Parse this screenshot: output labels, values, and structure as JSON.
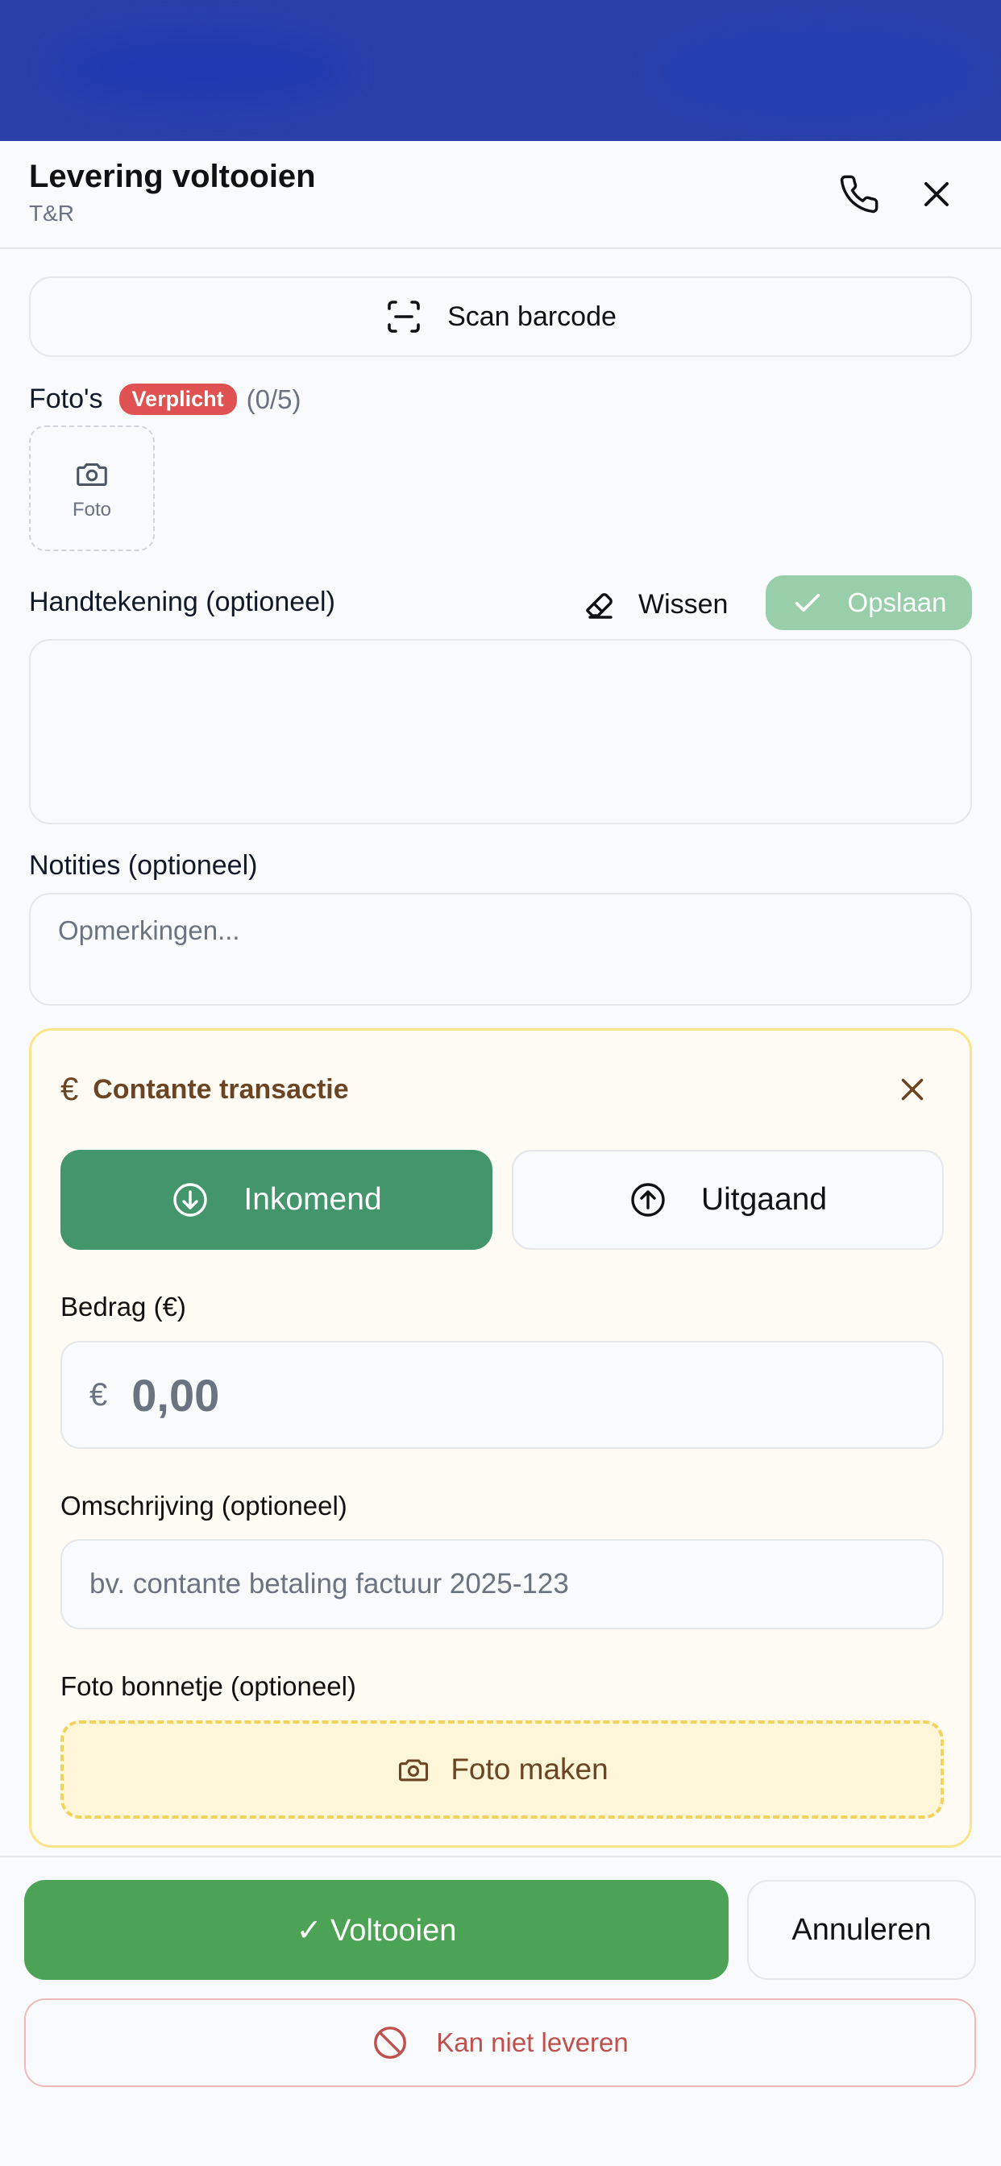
{
  "header": {
    "title": "Levering voltooien",
    "subtitle": "T&R",
    "phone_icon": "phone-icon",
    "close_icon": "close-icon"
  },
  "scan": {
    "label": "Scan barcode",
    "icon": "barcode-scan-icon"
  },
  "photos": {
    "label": "Foto's",
    "badge": "Verplicht",
    "count": "(0/5)",
    "slot_label": "Foto",
    "slot_icon": "camera-icon"
  },
  "signature": {
    "label": "Handtekening (optioneel)",
    "clear_label": "Wissen",
    "save_label": "Opslaan"
  },
  "notes": {
    "label": "Notities (optioneel)",
    "placeholder": "Opmerkingen..."
  },
  "cash": {
    "title": "Contante transactie",
    "currency_symbol": "€",
    "incoming_label": "Inkomend",
    "outgoing_label": "Uitgaand",
    "amount_label": "Bedrag (€)",
    "amount_value": "0,00",
    "description_label": "Omschrijving (optioneel)",
    "description_placeholder": "bv. contante betaling factuur 2025-123",
    "receipt_label": "Foto bonnetje (optioneel)",
    "receipt_button": "Foto maken",
    "selected_direction": "Inkomend"
  },
  "footer": {
    "complete_label": "✓ Voltooien",
    "cancel_label": "Annuleren",
    "fail_label": "Kan niet leveren"
  },
  "colors": {
    "top_bar": "#2a3faa",
    "incoming_active": "#43956b",
    "complete": "#4da355",
    "required_badge": "#e05252",
    "cash_border": "#fbe48a",
    "fail_text": "#c0504d"
  }
}
